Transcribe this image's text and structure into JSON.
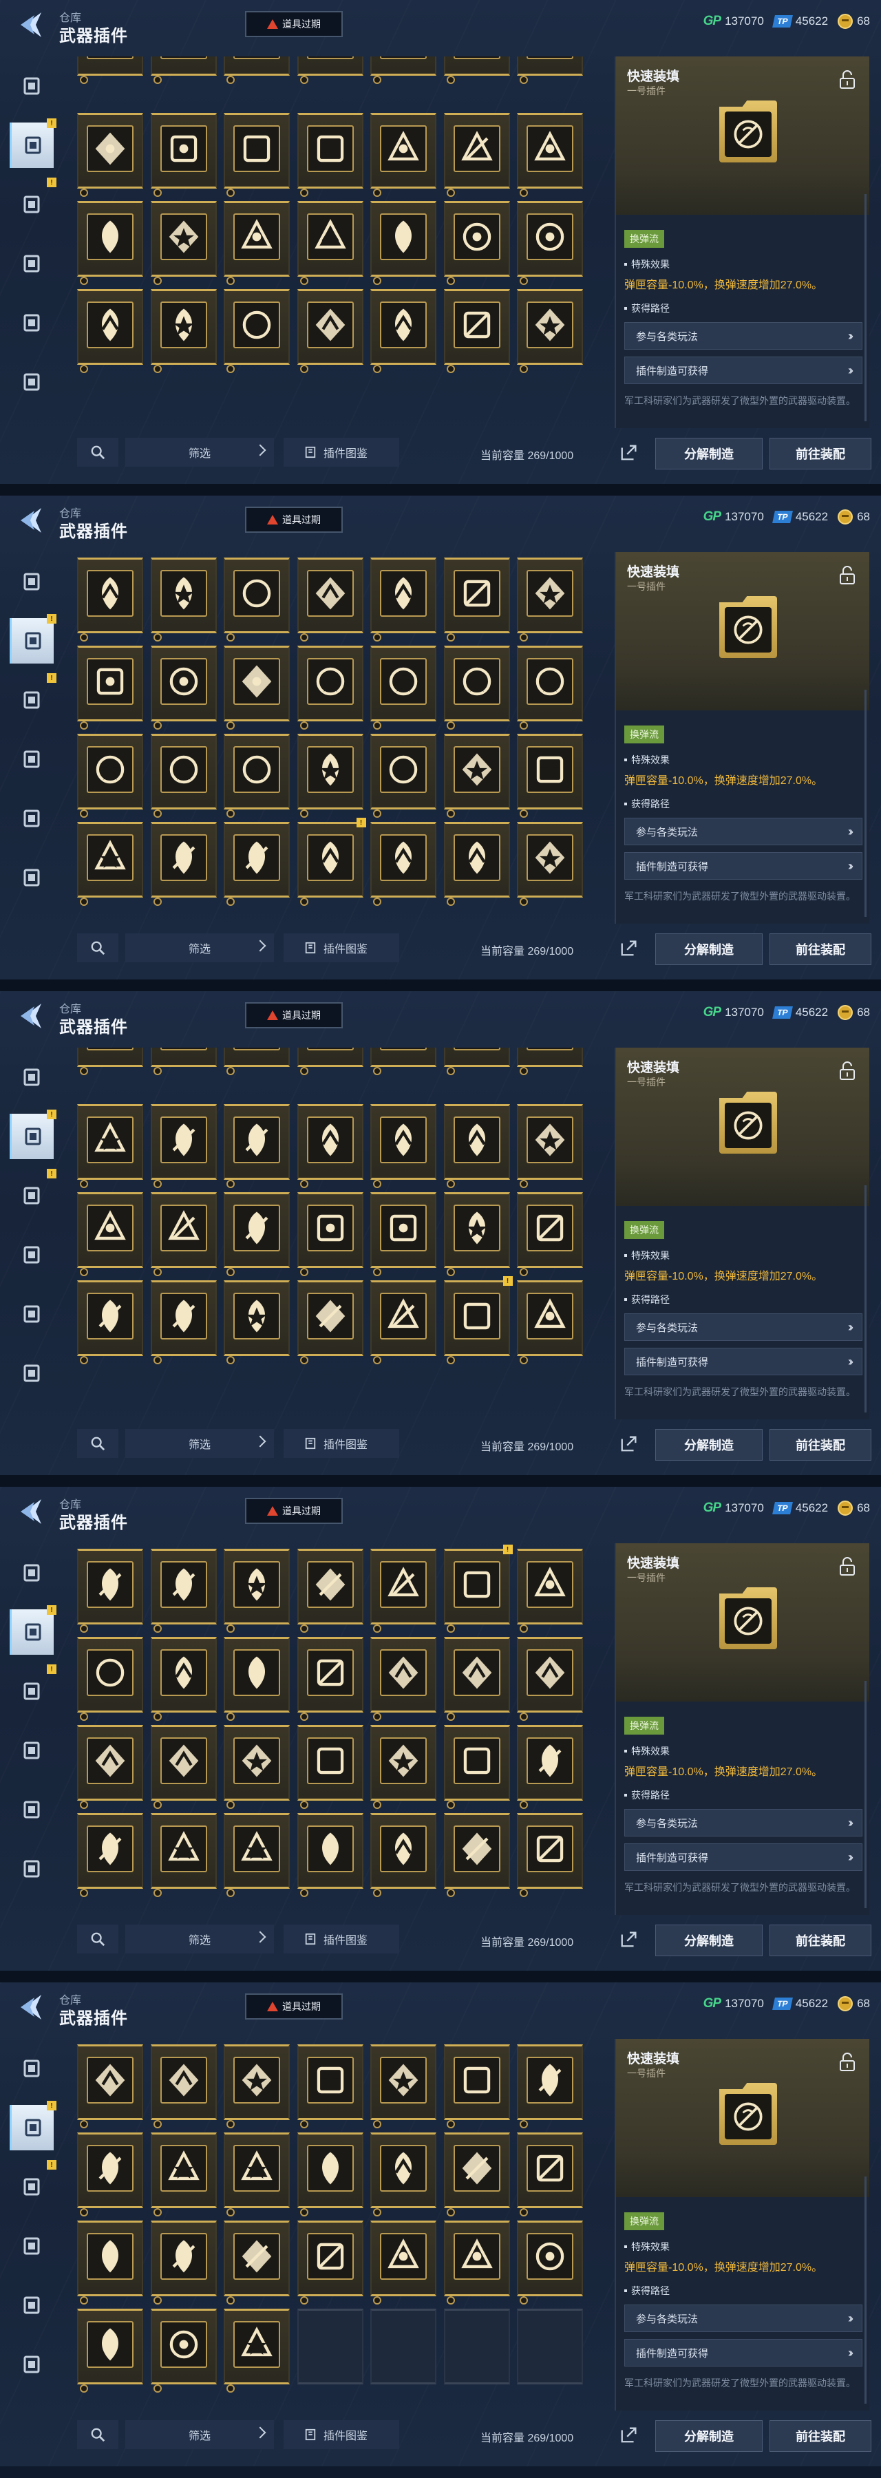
{
  "header": {
    "breadcrumb": "仓库",
    "title": "武器插件",
    "expired_button": "道具过期",
    "currencies": [
      {
        "icon": "gp-currency-icon",
        "label": "GP",
        "value": "137070"
      },
      {
        "icon": "tp-currency-icon",
        "label": "TP",
        "value": "45622"
      },
      {
        "icon": "coin-currency-icon",
        "label": "",
        "value": "68"
      }
    ]
  },
  "sidebar": {
    "items": [
      {
        "icon": "pistol-icon",
        "active": false,
        "badge": ""
      },
      {
        "icon": "plugin-chip-icon",
        "active": true,
        "badge": "!"
      },
      {
        "icon": "tag-icon",
        "active": false,
        "badge": "!"
      },
      {
        "icon": "gear-crate-icon",
        "active": false,
        "badge": ""
      },
      {
        "icon": "a-emblem-icon",
        "active": false,
        "badge": ""
      },
      {
        "icon": "star-badge-icon",
        "active": false,
        "badge": ""
      }
    ]
  },
  "bottom": {
    "filter_label": "筛选",
    "codex_label": "插件图鉴",
    "capacity": "当前容量 269/1000",
    "decompose_button": "分解制造",
    "goto_button": "前往装配"
  },
  "detail": {
    "name": "快速装填",
    "subtitle": "一号插件",
    "tag": "换弹流",
    "effect_heading": "特殊效果",
    "effect_text": "弹匣容量-10.0%，换弹速度增加27.0%。",
    "source_heading": "获得路径",
    "sources": [
      "参与各类玩法",
      "插件制造可获得"
    ],
    "flavor": "军工科研家们为武器研发了微型外置的武器驱动装置。"
  },
  "accent_colors": {
    "gold": "#cfae56",
    "effect": "#f1b93a",
    "gp": "#46d58a",
    "tag": "#6a9a3c",
    "warning": "#e0452f"
  },
  "panels": [
    {
      "rows": [
        {
          "partial": true,
          "icons": [
            "flame",
            "flame",
            "flame",
            "wings",
            "crest",
            "gear",
            "flower"
          ],
          "badges": []
        },
        {
          "partial": false,
          "icons": [
            "star-circle",
            "triangle-star",
            "tree",
            "tree",
            "cog-star",
            "shield-arrow",
            "arrow-left"
          ],
          "badges": []
        },
        {
          "partial": false,
          "icons": [
            "sunburst",
            "slash-circle",
            "no-sign",
            "swirl",
            "lightning",
            "blades",
            "blades"
          ],
          "badges": []
        },
        {
          "partial": false,
          "icons": [
            "crown",
            "bull",
            "helmet",
            "cage",
            "bulb",
            "target",
            "skull-ring"
          ],
          "badges": []
        }
      ]
    },
    {
      "rows": [
        {
          "partial": false,
          "icons": [
            "crown",
            "bull",
            "helmet",
            "cage",
            "bulb",
            "target",
            "skull-ring"
          ],
          "badges": []
        },
        {
          "partial": false,
          "icons": [
            "leaf",
            "pistol",
            "shield-face",
            "ring",
            "ring",
            "ring",
            "ring"
          ],
          "badges": []
        },
        {
          "partial": false,
          "icons": [
            "ring",
            "ring",
            "ring",
            "check-circle",
            "spike",
            "slash-circle",
            "gear"
          ],
          "badges": []
        },
        {
          "partial": false,
          "icons": [
            "skull",
            "beast",
            "beast",
            "splash",
            "splash",
            "crown",
            "fan"
          ],
          "badges": [
            3
          ]
        }
      ]
    },
    {
      "rows": [
        {
          "partial": true,
          "icons": [
            "ring",
            "ring",
            "ring",
            "check-circle",
            "spike",
            "slash-circle",
            "gear"
          ],
          "badges": [
            3
          ]
        },
        {
          "partial": false,
          "icons": [
            "skull",
            "beast",
            "beast",
            "splash",
            "splash",
            "crown",
            "fan"
          ],
          "badges": []
        },
        {
          "partial": false,
          "icons": [
            "robot",
            "dial",
            "peak",
            "star-spin",
            "star-spin",
            "hex-net",
            "mech"
          ],
          "badges": []
        },
        {
          "partial": false,
          "icons": [
            "bullet",
            "bullet",
            "hand",
            "speed",
            "spiral",
            "flame-hand",
            "burst"
          ],
          "badges": [
            5
          ]
        }
      ]
    },
    {
      "rows": [
        {
          "partial": false,
          "icons": [
            "bullet",
            "bullet",
            "hand",
            "speed",
            "spiral",
            "flame-hand",
            "burst"
          ],
          "badges": [
            5
          ]
        },
        {
          "partial": false,
          "icons": [
            "horse",
            "tri-gem",
            "mountain",
            "arrow-up",
            "claws",
            "claws",
            "claws"
          ],
          "badges": []
        },
        {
          "partial": false,
          "icons": [
            "claws",
            "claws",
            "down-arrow",
            "hex",
            "flame-c",
            "crescent",
            "orbit"
          ],
          "badges": []
        },
        {
          "partial": false,
          "icons": [
            "link",
            "scratch",
            "scratch",
            "cross-dots",
            "shield-x",
            "dragon",
            "recycle"
          ],
          "badges": []
        }
      ]
    },
    {
      "rows": [
        {
          "partial": false,
          "icons": [
            "claws",
            "claws",
            "down-arrow",
            "hex",
            "flame-c",
            "crescent",
            "orbit"
          ],
          "badges": []
        },
        {
          "partial": false,
          "icons": [
            "link",
            "scratch",
            "scratch",
            "cross-dots",
            "shield-x",
            "dragon",
            "recycle"
          ],
          "badges": []
        },
        {
          "partial": false,
          "icons": [
            "lightning",
            "beast",
            "crossed",
            "no-entry",
            "no-sign",
            "no-sign",
            "ghost"
          ],
          "badges": []
        },
        {
          "partial": false,
          "icons": [
            "lightning",
            "leaf-bird",
            "flower-burst",
            "",
            "",
            "",
            ""
          ],
          "badges": []
        }
      ]
    }
  ]
}
